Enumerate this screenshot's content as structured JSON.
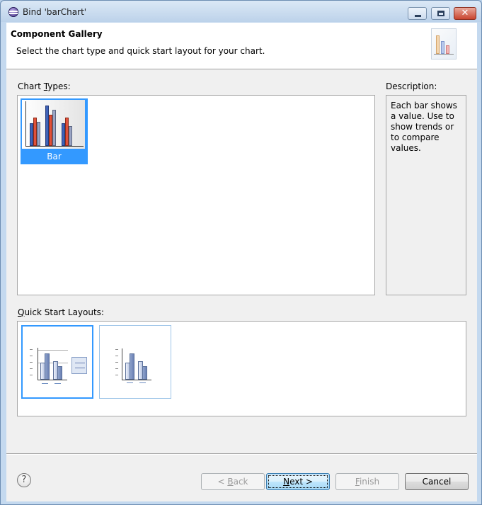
{
  "window": {
    "title": "Bind 'barChart'"
  },
  "header": {
    "title": "Component Gallery",
    "description": "Select the chart type and quick start layout for your chart."
  },
  "chart_types": {
    "label_pre": "Chart ",
    "label_mnemonic": "T",
    "label_post": "ypes:",
    "items": [
      {
        "label": "Bar",
        "selected": true
      }
    ]
  },
  "description": {
    "label": "Description:",
    "text": "Each bar shows a value. Use to show trends or to compare values."
  },
  "quick_start": {
    "label_mnemonic": "Q",
    "label_post": "uick Start Layouts:",
    "layouts": [
      {
        "name": "bar-with-legend",
        "selected": true
      },
      {
        "name": "bar-without-legend",
        "selected": false
      }
    ]
  },
  "buttons": {
    "back": {
      "pre": "< ",
      "mnemonic": "B",
      "post": "ack",
      "enabled": false
    },
    "next": {
      "mnemonic": "N",
      "post": "ext >",
      "enabled": true
    },
    "finish": {
      "mnemonic": "F",
      "post": "inish",
      "enabled": false
    },
    "cancel": {
      "label": "Cancel",
      "enabled": true
    }
  },
  "help_glyph": "?",
  "colors": {
    "selection": "#3399ff",
    "titlebar": "#c4d9ef",
    "bar_blue": "#3f63b8",
    "bar_red": "#e0503a",
    "bar_gray": "#9aa4c4"
  },
  "icons": [
    "app-icon",
    "minimize-icon",
    "maximize-icon",
    "close-icon",
    "wizard-chart-icon",
    "bar-chart-icon",
    "help-icon"
  ]
}
